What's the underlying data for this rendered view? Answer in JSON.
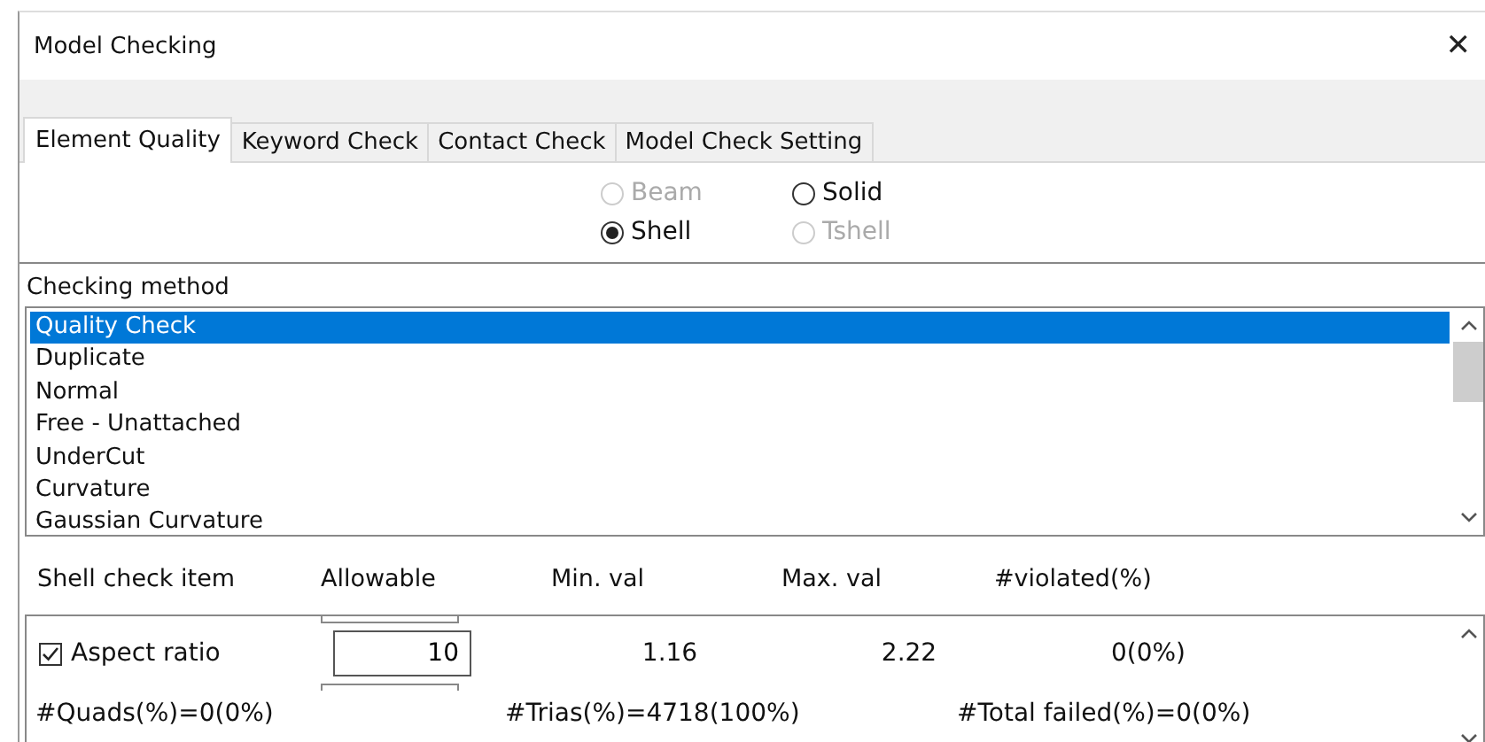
{
  "window": {
    "title": "Model Checking",
    "close": "✕"
  },
  "tabs": [
    {
      "label": "Element Quality",
      "selected": true
    },
    {
      "label": "Keyword Check",
      "selected": false
    },
    {
      "label": "Contact Check",
      "selected": false
    },
    {
      "label": "Model Check Setting",
      "selected": false
    }
  ],
  "element_types": [
    {
      "label": "Beam",
      "selected": false,
      "disabled": true
    },
    {
      "label": "Solid",
      "selected": false,
      "disabled": false
    },
    {
      "label": "Shell",
      "selected": true,
      "disabled": false
    },
    {
      "label": "Tshell",
      "selected": false,
      "disabled": true
    }
  ],
  "checking_method": {
    "label": "Checking method",
    "items": [
      {
        "label": "Quality Check",
        "selected": true
      },
      {
        "label": "Duplicate",
        "selected": false
      },
      {
        "label": "Normal",
        "selected": false
      },
      {
        "label": "Free - Unattached",
        "selected": false
      },
      {
        "label": "UnderCut",
        "selected": false
      },
      {
        "label": "Curvature",
        "selected": false
      },
      {
        "label": "Gaussian Curvature",
        "selected": false
      }
    ]
  },
  "check_table": {
    "columns": [
      "Shell check item",
      "Allowable",
      "Min. val",
      "Max. val",
      "#violated(%)"
    ],
    "rows": [
      {
        "item": "Aspect ratio",
        "checked": true,
        "allowable": "10",
        "min": "1.16",
        "max": "2.22",
        "violated": "0(0%)"
      }
    ],
    "summary": [
      "#Quads(%)=0(0%)",
      "#Trias(%)=4718(100%)",
      "#Total failed(%)=0(0%)"
    ]
  }
}
